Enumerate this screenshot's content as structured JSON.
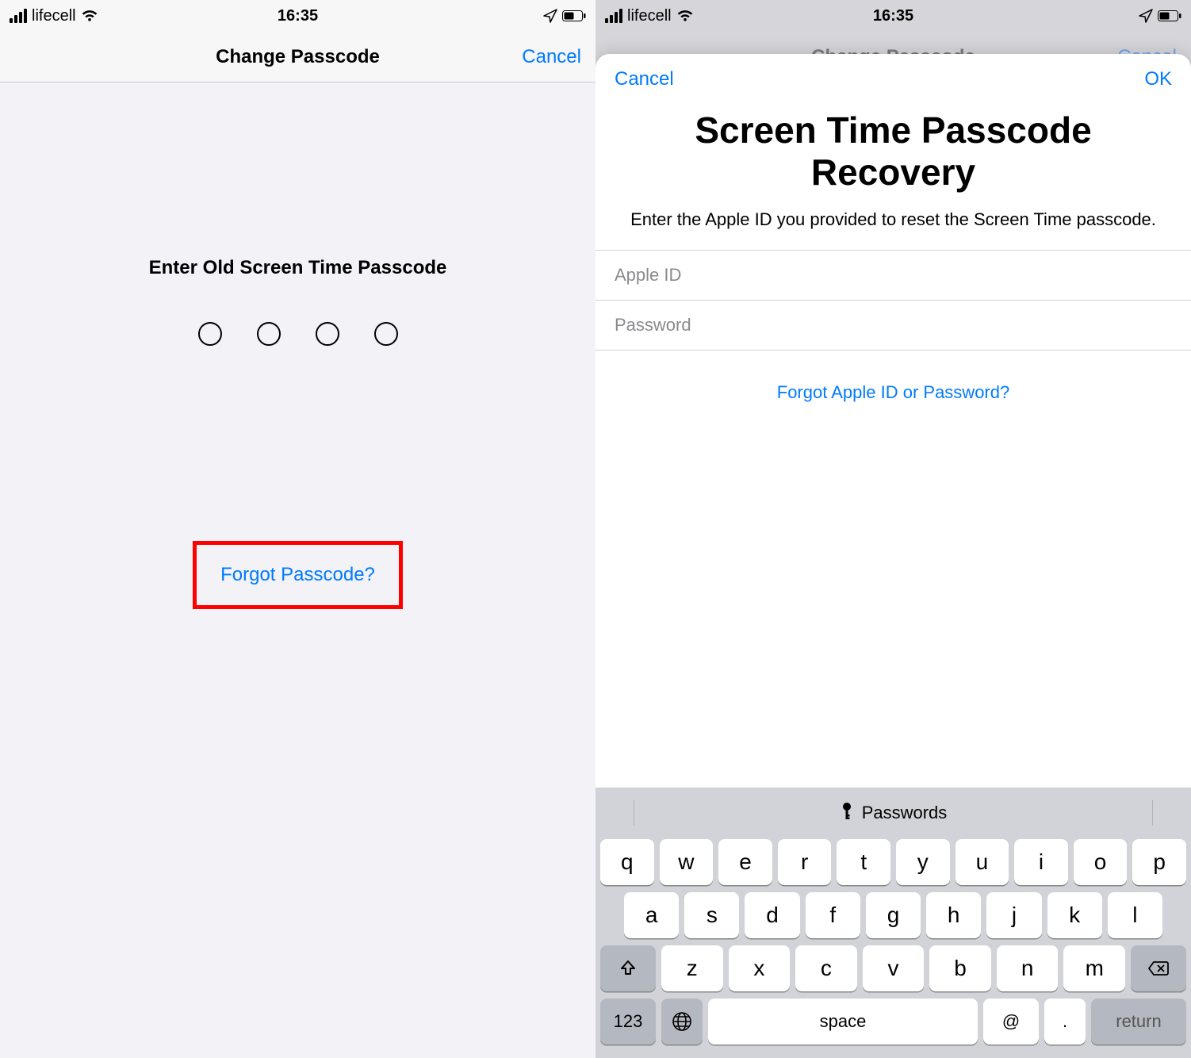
{
  "status": {
    "carrier": "lifecell",
    "time": "16:35"
  },
  "left": {
    "nav_title": "Change Passcode",
    "nav_cancel": "Cancel",
    "prompt": "Enter Old Screen Time Passcode",
    "forgot": "Forgot Passcode?"
  },
  "right": {
    "back_title": "Change Passcode",
    "back_cancel": "Cancel",
    "sheet_cancel": "Cancel",
    "sheet_ok": "OK",
    "title": "Screen Time Passcode Recovery",
    "subtitle": "Enter the Apple ID you provided to reset the Screen Time passcode.",
    "appleid_placeholder": "Apple ID",
    "password_placeholder": "Password",
    "forgot": "Forgot Apple ID or Password?"
  },
  "keyboard": {
    "suggestion": "Passwords",
    "row1": [
      "q",
      "w",
      "e",
      "r",
      "t",
      "y",
      "u",
      "i",
      "o",
      "p"
    ],
    "row2": [
      "a",
      "s",
      "d",
      "f",
      "g",
      "h",
      "j",
      "k",
      "l"
    ],
    "row3": [
      "z",
      "x",
      "c",
      "v",
      "b",
      "n",
      "m"
    ],
    "k123": "123",
    "space": "space",
    "at": "@",
    "dot": ".",
    "ret": "return"
  }
}
